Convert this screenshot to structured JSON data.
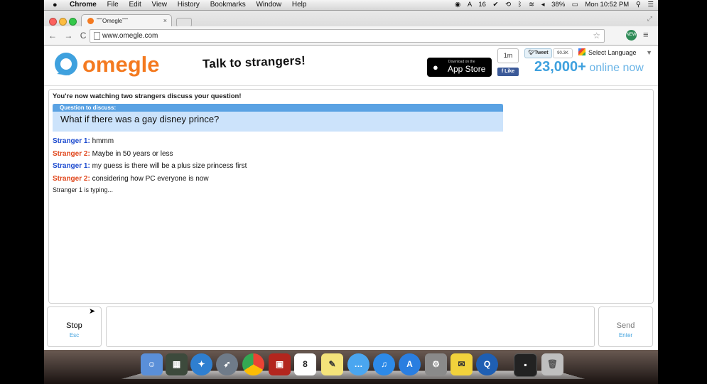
{
  "menubar": {
    "apple": "",
    "app_name": "Chrome",
    "menus": [
      "File",
      "Edit",
      "View",
      "History",
      "Bookmarks",
      "Window",
      "Help"
    ],
    "battery": "38%",
    "clock": "Mon 10:52 PM",
    "icon_count": "16"
  },
  "browser": {
    "tab_title": "˜˜˜Omegle˜˜˜",
    "tab_close": "×",
    "url": "www.omegle.com",
    "nav_back": "←",
    "nav_forward": "→",
    "nav_reload": "C",
    "star": "☆",
    "menu": "≡"
  },
  "header": {
    "logo_text": "omegle",
    "tagline": "Talk to strangers!",
    "appstore_small": "Download on the",
    "appstore_big": "App Store",
    "fb_count": "1m",
    "fb_like": "Like",
    "tweet_label": "Tweet",
    "tweet_count": "90.3K",
    "language_label": "Select Language",
    "online_count": "23,000+",
    "online_text": "online now"
  },
  "chat": {
    "status": "You're now watching two strangers discuss your question!",
    "question_header": "Question to discuss:",
    "question": "What if there was a gay disney prince?",
    "messages": [
      {
        "speaker": "Stranger 1:",
        "text": "hmmm"
      },
      {
        "speaker": "Stranger 2:",
        "text": "Maybe in 50 years or less"
      },
      {
        "speaker": "Stranger 1:",
        "text": "my guess is there will be a plus size princess first"
      },
      {
        "speaker": "Stranger 2:",
        "text": "considering how PC everyone is now"
      }
    ],
    "typing": "Stranger 1 is typing..."
  },
  "controls": {
    "stop_label": "Stop",
    "stop_key": "Esc",
    "send_label": "Send",
    "send_key": "Enter",
    "message_value": ""
  },
  "dock": {
    "calendar_day": "8",
    "apps": [
      "finder",
      "photo-browser",
      "safari",
      "launchpad",
      "chrome",
      "photo-booth",
      "calendar",
      "stickies",
      "messages",
      "itunes",
      "app-store",
      "system-preferences",
      "notes",
      "quicktime",
      "terminal",
      "trash"
    ]
  },
  "colors": {
    "accent": "#3fa1de",
    "stranger1": "#1d4bcf",
    "stranger2": "#e0461b",
    "question_bg": "#cce3fb",
    "logo_orange": "#f47a20"
  }
}
